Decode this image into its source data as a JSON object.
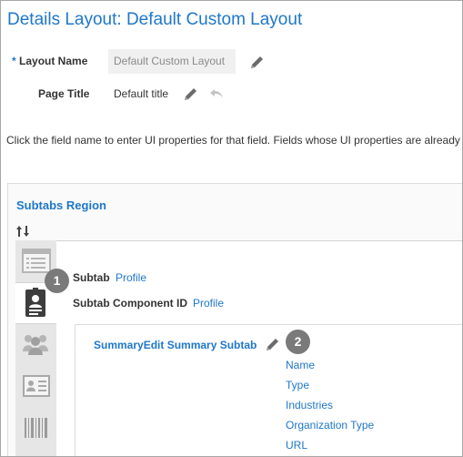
{
  "header": {
    "title": "Details Layout: Default Custom Layout"
  },
  "form": {
    "required_marker": "*",
    "layout_name_label": "Layout Name",
    "layout_name_value": "Default Custom Layout",
    "page_title_label": "Page Title",
    "page_title_value": "Default title"
  },
  "instruction": "Click the field name to enter UI properties for that field. Fields whose UI properties are already",
  "subtabs_region": {
    "title": "Subtabs Region",
    "tabs": [
      {
        "icon": "list-icon",
        "active": false
      },
      {
        "icon": "contact-card-icon",
        "active": true
      },
      {
        "icon": "team-icon",
        "active": false
      },
      {
        "icon": "id-card-icon",
        "active": false
      },
      {
        "icon": "barcode-icon",
        "active": false
      }
    ],
    "subtab_label": "Subtab",
    "subtab_value": "Profile",
    "component_id_label": "Subtab Component ID",
    "component_id_value": "Profile",
    "callouts": [
      "1",
      "2"
    ],
    "summary": {
      "title": "SummaryEdit Summary Subtab",
      "fields": [
        "Name",
        "Type",
        "Industries",
        "Organization Type",
        "URL"
      ]
    }
  },
  "colors": {
    "accent": "#1f77c9",
    "badge": "#7a7a7a",
    "input_bg": "#f0f0f0"
  }
}
